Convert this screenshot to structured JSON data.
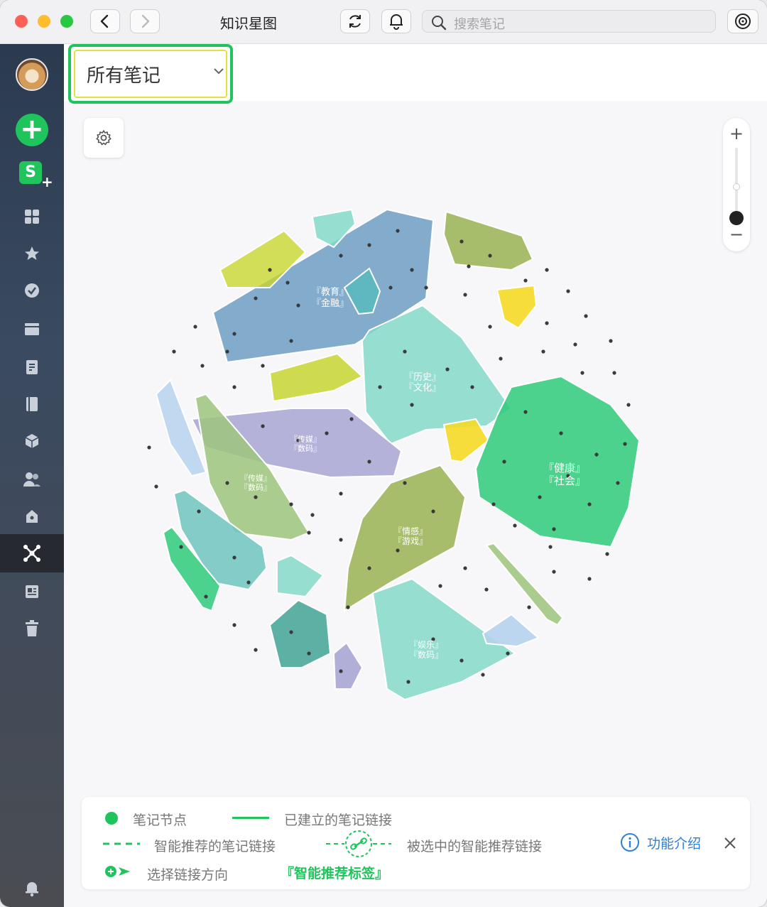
{
  "titlebar": {
    "title": "知识星图",
    "search_placeholder": "搜索笔记",
    "icons": [
      "chevron-left-icon",
      "chevron-right-icon",
      "refresh-icon",
      "bell-icon",
      "search-icon",
      "target-icon"
    ]
  },
  "sidebar": {
    "items": [
      "avatar",
      "new-note",
      "s-plus",
      "grid",
      "star",
      "check",
      "folder",
      "note",
      "notebook",
      "cube",
      "users",
      "lock",
      "knowledge-graph",
      "clipping",
      "trash",
      "bell"
    ],
    "active": "knowledge-graph"
  },
  "filter": {
    "selected": "所有笔记"
  },
  "graph": {
    "clusters": [
      {
        "id": "c1",
        "label1": "『教育』",
        "label2": "『金融』",
        "color": "#6f9fc4"
      },
      {
        "id": "c2",
        "label1": "『历史』",
        "label2": "『文化』",
        "color": "#84d9c9"
      },
      {
        "id": "c3",
        "label1": "『健康』",
        "label2": "『社会』",
        "color": "#2ecb7a"
      },
      {
        "id": "c4",
        "label1": "『传媒』",
        "label2": "『数码』",
        "color": "#a9a6d4"
      },
      {
        "id": "c5",
        "label1": "『传媒』",
        "label2": "『数码』",
        "color": "#9dc47c"
      },
      {
        "id": "c6",
        "label1": "『情感』",
        "label2": "『游戏』",
        "color": "#9ab352"
      },
      {
        "id": "c7",
        "label1": "『娱乐』",
        "label2": "『数码』",
        "color": "#84d9c9"
      }
    ]
  },
  "legend": {
    "node": "笔记节点",
    "established_link": "已建立的笔记链接",
    "suggested_link": "智能推荐的笔记链接",
    "selected_suggested_link": "被选中的智能推荐链接",
    "select_direction": "选择链接方向",
    "smart_tag": "『智能推荐标签』",
    "feature_intro": "功能介绍",
    "accent_color": "#1fc55c",
    "link_color": "#2f7fd6"
  }
}
